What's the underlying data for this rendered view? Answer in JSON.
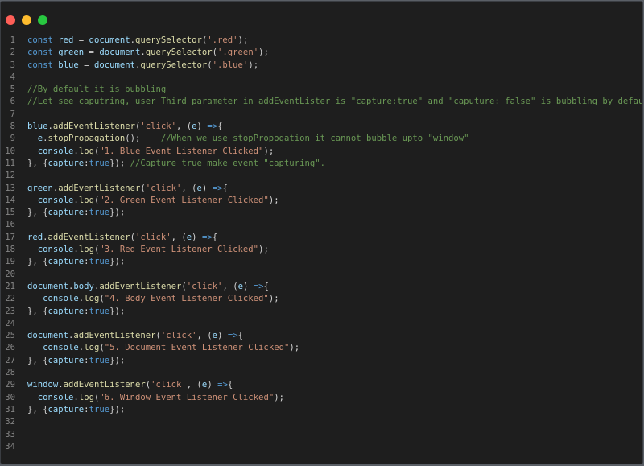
{
  "window": {
    "controls": [
      "close",
      "minimize",
      "maximize"
    ],
    "colors": {
      "close": "#ff5f57",
      "minimize": "#febc2e",
      "maximize": "#28c840",
      "background": "#1e1e1e"
    }
  },
  "editor": {
    "language": "javascript",
    "lines": [
      {
        "n": "1",
        "tokens": [
          [
            "kw",
            "const"
          ],
          [
            "plain",
            " "
          ],
          [
            "var",
            "red"
          ],
          [
            "plain",
            " = "
          ],
          [
            "var",
            "document"
          ],
          [
            "plain",
            "."
          ],
          [
            "fn",
            "querySelector"
          ],
          [
            "plain",
            "("
          ],
          [
            "str",
            "'.red'"
          ],
          [
            "plain",
            ");"
          ]
        ]
      },
      {
        "n": "2",
        "tokens": [
          [
            "kw",
            "const"
          ],
          [
            "plain",
            " "
          ],
          [
            "var",
            "green"
          ],
          [
            "plain",
            " = "
          ],
          [
            "var",
            "document"
          ],
          [
            "plain",
            "."
          ],
          [
            "fn",
            "querySelector"
          ],
          [
            "plain",
            "("
          ],
          [
            "str",
            "'.green'"
          ],
          [
            "plain",
            ");"
          ]
        ]
      },
      {
        "n": "3",
        "tokens": [
          [
            "kw",
            "const"
          ],
          [
            "plain",
            " "
          ],
          [
            "var",
            "blue"
          ],
          [
            "plain",
            " = "
          ],
          [
            "var",
            "document"
          ],
          [
            "plain",
            "."
          ],
          [
            "fn",
            "querySelector"
          ],
          [
            "plain",
            "("
          ],
          [
            "str",
            "'.blue'"
          ],
          [
            "plain",
            ");"
          ]
        ]
      },
      {
        "n": "4",
        "tokens": []
      },
      {
        "n": "5",
        "tokens": [
          [
            "com",
            "//By default it is bubbling"
          ]
        ]
      },
      {
        "n": "6",
        "tokens": [
          [
            "com",
            "//Let see caputring, user Third parameter in addEventLister is \"capture:true\" and \"caputure: false\" is bubbling by default"
          ]
        ]
      },
      {
        "n": "7",
        "tokens": []
      },
      {
        "n": "8",
        "tokens": [
          [
            "var",
            "blue"
          ],
          [
            "plain",
            "."
          ],
          [
            "fn",
            "addEventListener"
          ],
          [
            "plain",
            "("
          ],
          [
            "str",
            "'click'"
          ],
          [
            "plain",
            ", ("
          ],
          [
            "var",
            "e"
          ],
          [
            "plain",
            ") "
          ],
          [
            "kw",
            "=>"
          ],
          [
            "plain",
            "{"
          ]
        ]
      },
      {
        "n": "9",
        "tokens": [
          [
            "plain",
            "  "
          ],
          [
            "var",
            "e"
          ],
          [
            "plain",
            "."
          ],
          [
            "fn",
            "stopPropagation"
          ],
          [
            "plain",
            "();    "
          ],
          [
            "com",
            "//When we use stopPropogation it cannot bubble upto \"window\""
          ]
        ]
      },
      {
        "n": "10",
        "tokens": [
          [
            "plain",
            "  "
          ],
          [
            "var",
            "console"
          ],
          [
            "plain",
            "."
          ],
          [
            "fn",
            "log"
          ],
          [
            "plain",
            "("
          ],
          [
            "str",
            "\"1. Blue Event Listener Clicked\""
          ],
          [
            "plain",
            ");"
          ]
        ]
      },
      {
        "n": "11",
        "tokens": [
          [
            "plain",
            "}, {"
          ],
          [
            "var",
            "capture"
          ],
          [
            "plain",
            ":"
          ],
          [
            "bool",
            "true"
          ],
          [
            "plain",
            "}); "
          ],
          [
            "com",
            "//Capture true make event \"capturing\"."
          ]
        ]
      },
      {
        "n": "12",
        "tokens": []
      },
      {
        "n": "13",
        "tokens": [
          [
            "var",
            "green"
          ],
          [
            "plain",
            "."
          ],
          [
            "fn",
            "addEventListener"
          ],
          [
            "plain",
            "("
          ],
          [
            "str",
            "'click'"
          ],
          [
            "plain",
            ", ("
          ],
          [
            "var",
            "e"
          ],
          [
            "plain",
            ") "
          ],
          [
            "kw",
            "=>"
          ],
          [
            "plain",
            "{"
          ]
        ]
      },
      {
        "n": "14",
        "tokens": [
          [
            "plain",
            "  "
          ],
          [
            "var",
            "console"
          ],
          [
            "plain",
            "."
          ],
          [
            "fn",
            "log"
          ],
          [
            "plain",
            "("
          ],
          [
            "str",
            "\"2. Green Event Listener Clicked\""
          ],
          [
            "plain",
            ");"
          ]
        ]
      },
      {
        "n": "15",
        "tokens": [
          [
            "plain",
            "}, {"
          ],
          [
            "var",
            "capture"
          ],
          [
            "plain",
            ":"
          ],
          [
            "bool",
            "true"
          ],
          [
            "plain",
            "});"
          ]
        ]
      },
      {
        "n": "16",
        "tokens": []
      },
      {
        "n": "17",
        "tokens": [
          [
            "var",
            "red"
          ],
          [
            "plain",
            "."
          ],
          [
            "fn",
            "addEventListener"
          ],
          [
            "plain",
            "("
          ],
          [
            "str",
            "'click'"
          ],
          [
            "plain",
            ", ("
          ],
          [
            "var",
            "e"
          ],
          [
            "plain",
            ") "
          ],
          [
            "kw",
            "=>"
          ],
          [
            "plain",
            "{"
          ]
        ]
      },
      {
        "n": "18",
        "tokens": [
          [
            "plain",
            "  "
          ],
          [
            "var",
            "console"
          ],
          [
            "plain",
            "."
          ],
          [
            "fn",
            "log"
          ],
          [
            "plain",
            "("
          ],
          [
            "str",
            "\"3. Red Event Listener Clicked\""
          ],
          [
            "plain",
            ");"
          ]
        ]
      },
      {
        "n": "19",
        "tokens": [
          [
            "plain",
            "}, {"
          ],
          [
            "var",
            "capture"
          ],
          [
            "plain",
            ":"
          ],
          [
            "bool",
            "true"
          ],
          [
            "plain",
            "});"
          ]
        ]
      },
      {
        "n": "20",
        "tokens": []
      },
      {
        "n": "21",
        "tokens": [
          [
            "var",
            "document"
          ],
          [
            "plain",
            "."
          ],
          [
            "var",
            "body"
          ],
          [
            "plain",
            "."
          ],
          [
            "fn",
            "addEventListener"
          ],
          [
            "plain",
            "("
          ],
          [
            "str",
            "'click'"
          ],
          [
            "plain",
            ", ("
          ],
          [
            "var",
            "e"
          ],
          [
            "plain",
            ") "
          ],
          [
            "kw",
            "=>"
          ],
          [
            "plain",
            "{"
          ]
        ]
      },
      {
        "n": "22",
        "tokens": [
          [
            "plain",
            "   "
          ],
          [
            "var",
            "console"
          ],
          [
            "plain",
            "."
          ],
          [
            "fn",
            "log"
          ],
          [
            "plain",
            "("
          ],
          [
            "str",
            "\"4. Body Event Listener Clicked\""
          ],
          [
            "plain",
            ");"
          ]
        ]
      },
      {
        "n": "23",
        "tokens": [
          [
            "plain",
            "}, {"
          ],
          [
            "var",
            "capture"
          ],
          [
            "plain",
            ":"
          ],
          [
            "bool",
            "true"
          ],
          [
            "plain",
            "});"
          ]
        ]
      },
      {
        "n": "24",
        "tokens": []
      },
      {
        "n": "25",
        "tokens": [
          [
            "var",
            "document"
          ],
          [
            "plain",
            "."
          ],
          [
            "fn",
            "addEventListener"
          ],
          [
            "plain",
            "("
          ],
          [
            "str",
            "'click'"
          ],
          [
            "plain",
            ", ("
          ],
          [
            "var",
            "e"
          ],
          [
            "plain",
            ") "
          ],
          [
            "kw",
            "=>"
          ],
          [
            "plain",
            "{"
          ]
        ]
      },
      {
        "n": "26",
        "tokens": [
          [
            "plain",
            "   "
          ],
          [
            "var",
            "console"
          ],
          [
            "plain",
            "."
          ],
          [
            "fn",
            "log"
          ],
          [
            "plain",
            "("
          ],
          [
            "str",
            "\"5. Document Event Listener Clicked\""
          ],
          [
            "plain",
            ");"
          ]
        ]
      },
      {
        "n": "27",
        "tokens": [
          [
            "plain",
            "}, {"
          ],
          [
            "var",
            "capture"
          ],
          [
            "plain",
            ":"
          ],
          [
            "bool",
            "true"
          ],
          [
            "plain",
            "});"
          ]
        ]
      },
      {
        "n": "28",
        "tokens": []
      },
      {
        "n": "29",
        "tokens": [
          [
            "var",
            "window"
          ],
          [
            "plain",
            "."
          ],
          [
            "fn",
            "addEventListener"
          ],
          [
            "plain",
            "("
          ],
          [
            "str",
            "'click'"
          ],
          [
            "plain",
            ", ("
          ],
          [
            "var",
            "e"
          ],
          [
            "plain",
            ") "
          ],
          [
            "kw",
            "=>"
          ],
          [
            "plain",
            "{"
          ]
        ]
      },
      {
        "n": "30",
        "tokens": [
          [
            "plain",
            "  "
          ],
          [
            "var",
            "console"
          ],
          [
            "plain",
            "."
          ],
          [
            "fn",
            "log"
          ],
          [
            "plain",
            "("
          ],
          [
            "str",
            "\"6. Window Event Listener Clicked\""
          ],
          [
            "plain",
            ");"
          ]
        ]
      },
      {
        "n": "31",
        "tokens": [
          [
            "plain",
            "}, {"
          ],
          [
            "var",
            "capture"
          ],
          [
            "plain",
            ":"
          ],
          [
            "bool",
            "true"
          ],
          [
            "plain",
            "});"
          ]
        ]
      },
      {
        "n": "32",
        "tokens": []
      },
      {
        "n": "33",
        "tokens": []
      },
      {
        "n": "34",
        "tokens": []
      }
    ]
  }
}
